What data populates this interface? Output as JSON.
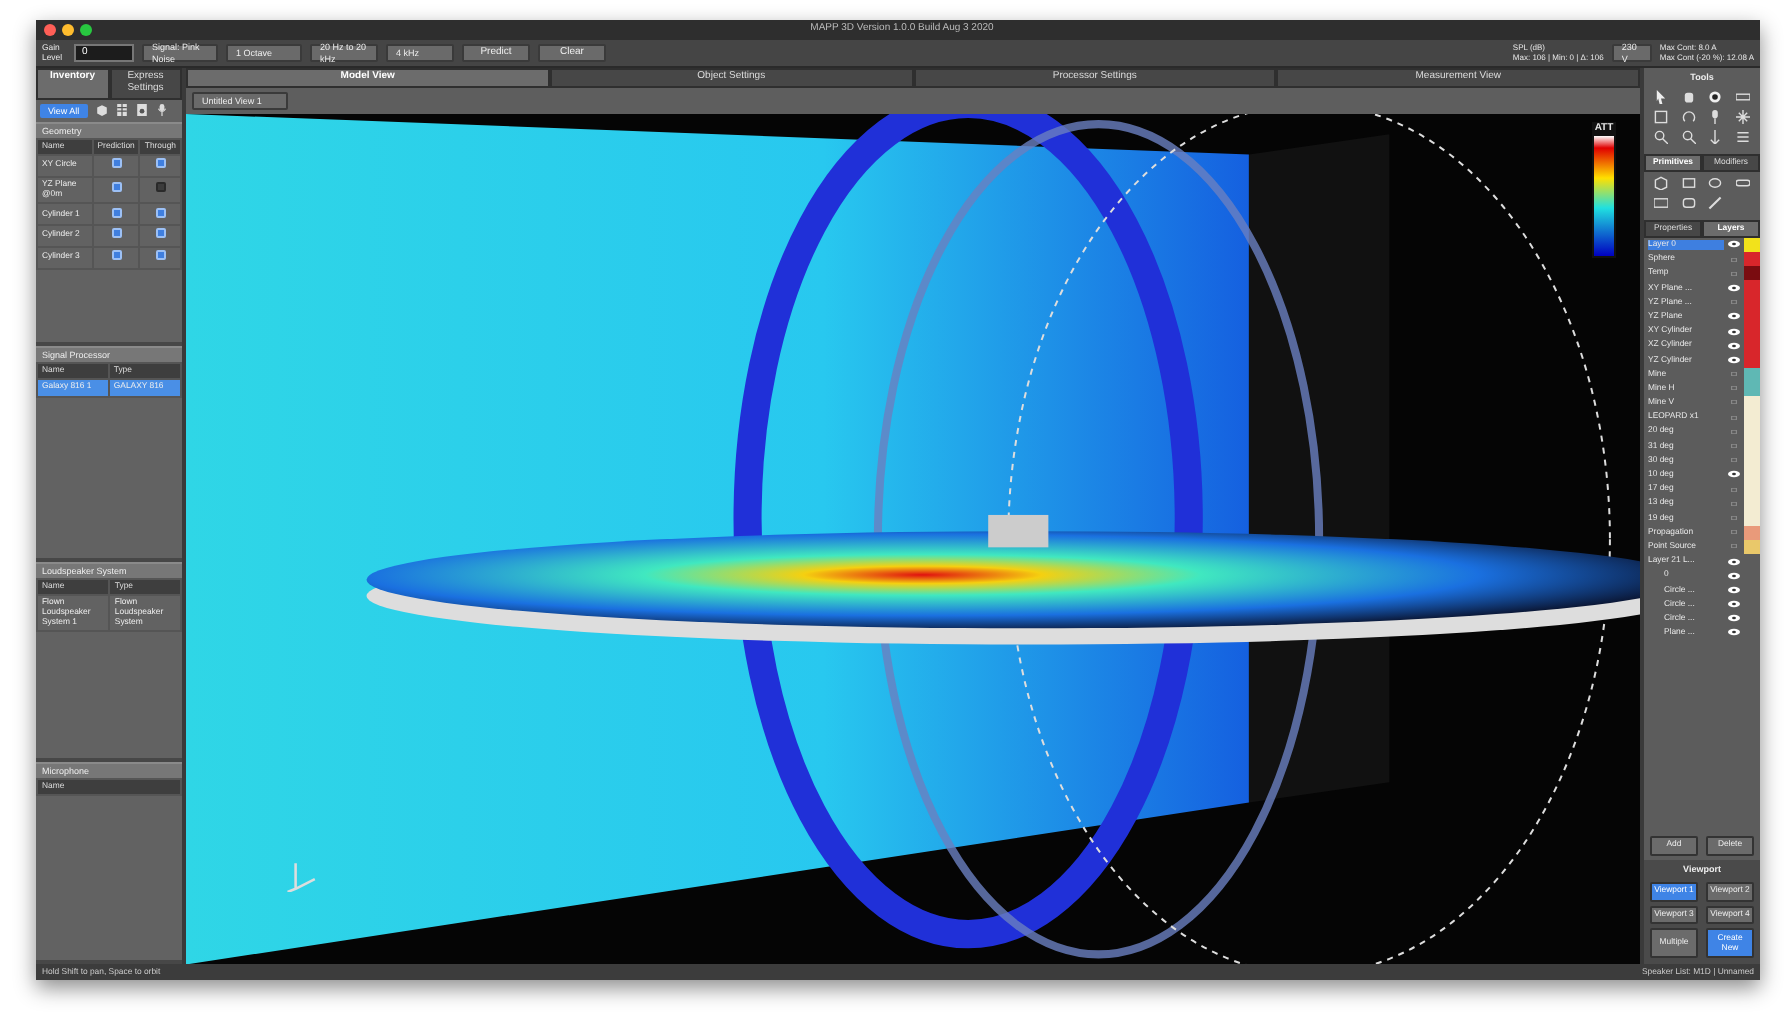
{
  "window": {
    "title": "MAPP 3D Version 1.0.0 Build Aug 3 2020"
  },
  "toolbar": {
    "gain_label": "Gain Level",
    "gain_value": "0",
    "dropdowns": [
      "Signal: Pink Noise",
      "1 Octave",
      "20 Hz to 20 kHz",
      "4 kHz"
    ],
    "buttons": [
      "Predict",
      "Clear"
    ],
    "spl_label": "SPL (dB)",
    "spl_readout": "Max: 106 | Min: 0 | Δ: 106",
    "voltage": "230 V",
    "current_lines": [
      "Max Cont: 8.0 A",
      "Max Cont (-20 %): 12.08 A"
    ]
  },
  "left_panel": {
    "tabs": [
      {
        "label": "Inventory",
        "selected": true
      },
      {
        "label": "Express Settings",
        "selected": false
      }
    ],
    "view_all": "View All",
    "geometry": {
      "title": "Geometry",
      "columns": [
        "Name",
        "Prediction",
        "Through"
      ],
      "rows": [
        {
          "name": "XY Circle",
          "prediction": true,
          "through": true
        },
        {
          "name": "YZ Plane @0m",
          "prediction": true,
          "through": false
        },
        {
          "name": "Cylinder 1",
          "prediction": true,
          "through": true
        },
        {
          "name": "Cylinder 2",
          "prediction": true,
          "through": true
        },
        {
          "name": "Cylinder 3",
          "prediction": true,
          "through": true
        }
      ]
    },
    "signal_processor": {
      "title": "Signal Processor",
      "columns": [
        "Name",
        "Type"
      ],
      "rows": [
        {
          "name": "Galaxy 816 1",
          "type": "GALAXY 816",
          "selected": true
        }
      ]
    },
    "loudspeaker_system": {
      "title": "Loudspeaker System",
      "columns": [
        "Name",
        "Type"
      ],
      "rows": [
        {
          "name": "Flown Loudspeaker System 1",
          "type": "Flown Loudspeaker System",
          "selected": false
        }
      ]
    },
    "microphone": {
      "title": "Microphone",
      "columns": [
        "Name"
      ]
    }
  },
  "center": {
    "tabs": [
      {
        "label": "Model View",
        "selected": true
      },
      {
        "label": "Object Settings",
        "selected": false
      },
      {
        "label": "Processor Settings",
        "selected": false
      },
      {
        "label": "Measurement View",
        "selected": false
      }
    ],
    "view_dropdown": "Untitled View 1",
    "scale_label": "ATT"
  },
  "right_panel": {
    "tools_title": "Tools",
    "primitive_tabs": [
      {
        "label": "Primitives",
        "selected": true
      },
      {
        "label": "Modifiers",
        "selected": false
      }
    ],
    "layer_tabs": [
      {
        "label": "Properties",
        "selected": false
      },
      {
        "label": "Layers",
        "selected": true
      }
    ],
    "layers": [
      {
        "name": "Layer 0",
        "visible": true,
        "color": "#f2e21b",
        "selected": true
      },
      {
        "name": "Sphere",
        "visible": false,
        "color": "#d8262b",
        "selected": false
      },
      {
        "name": "Temp",
        "visible": false,
        "color": "#7a0c10",
        "selected": false
      },
      {
        "name": "XY Plane ...",
        "visible": true,
        "color": "#d8262b",
        "selected": false
      },
      {
        "name": "YZ Plane ...",
        "visible": false,
        "color": "#d8262b",
        "selected": false
      },
      {
        "name": "YZ Plane",
        "visible": true,
        "color": "#d8262b",
        "selected": false
      },
      {
        "name": "XY Cylinder",
        "visible": true,
        "color": "#d8262b",
        "selected": false
      },
      {
        "name": "XZ Cylinder",
        "visible": true,
        "color": "#d8262b",
        "selected": false
      },
      {
        "name": "YZ Cylinder",
        "visible": true,
        "color": "#d8262b",
        "selected": false
      },
      {
        "name": "Mine",
        "visible": false,
        "color": "#5fb8b4",
        "selected": false
      },
      {
        "name": "Mine H",
        "visible": false,
        "color": "#5fb8b4",
        "selected": false
      },
      {
        "name": "Mine V",
        "visible": false,
        "color": "#f3ecd2",
        "selected": false
      },
      {
        "name": "LEOPARD x1",
        "visible": false,
        "color": "#f3ecd2",
        "selected": false
      },
      {
        "name": "20 deg",
        "visible": false,
        "color": "#f3ecd2",
        "selected": false
      },
      {
        "name": "31 deg",
        "visible": false,
        "color": "#f3ecd2",
        "selected": false
      },
      {
        "name": "30 deg",
        "visible": false,
        "color": "#f3ecd2",
        "selected": false
      },
      {
        "name": "10 deg",
        "visible": true,
        "color": "#f3ecd2",
        "selected": false
      },
      {
        "name": "17 deg",
        "visible": false,
        "color": "#f3ecd2",
        "selected": false
      },
      {
        "name": "13 deg",
        "visible": false,
        "color": "#f3ecd2",
        "selected": false
      },
      {
        "name": "19 deg",
        "visible": false,
        "color": "#f3ecd2",
        "selected": false
      },
      {
        "name": "Propagation",
        "visible": false,
        "color": "#e99a7a",
        "selected": false
      },
      {
        "name": "Point Source",
        "visible": false,
        "color": "#e9c86a",
        "selected": false
      },
      {
        "name": "Layer 21 L...",
        "visible": true,
        "selected": false,
        "children": [
          {
            "name": "0",
            "visible": true,
            "selected": false
          },
          {
            "name": "Circle ...",
            "visible": true,
            "selected": false
          },
          {
            "name": "Circle ...",
            "visible": true,
            "selected": false
          },
          {
            "name": "Circle ...",
            "visible": true,
            "selected": false
          },
          {
            "name": "Plane ...",
            "visible": true,
            "selected": false
          }
        ]
      }
    ],
    "layer_buttons": [
      "Add",
      "Delete"
    ],
    "viewport_title": "Viewport",
    "viewports": [
      {
        "label": "Viewport 1",
        "selected": true
      },
      {
        "label": "Viewport 2",
        "selected": false
      },
      {
        "label": "Viewport 3",
        "selected": false
      },
      {
        "label": "Viewport 4",
        "selected": false
      },
      {
        "label": "Multiple",
        "selected": false
      },
      {
        "label": "Create New",
        "selected": true
      }
    ]
  },
  "status_bar": {
    "hint": "Hold Shift to pan, Space to orbit",
    "speaker": "Speaker List: M1D | Unnamed"
  }
}
